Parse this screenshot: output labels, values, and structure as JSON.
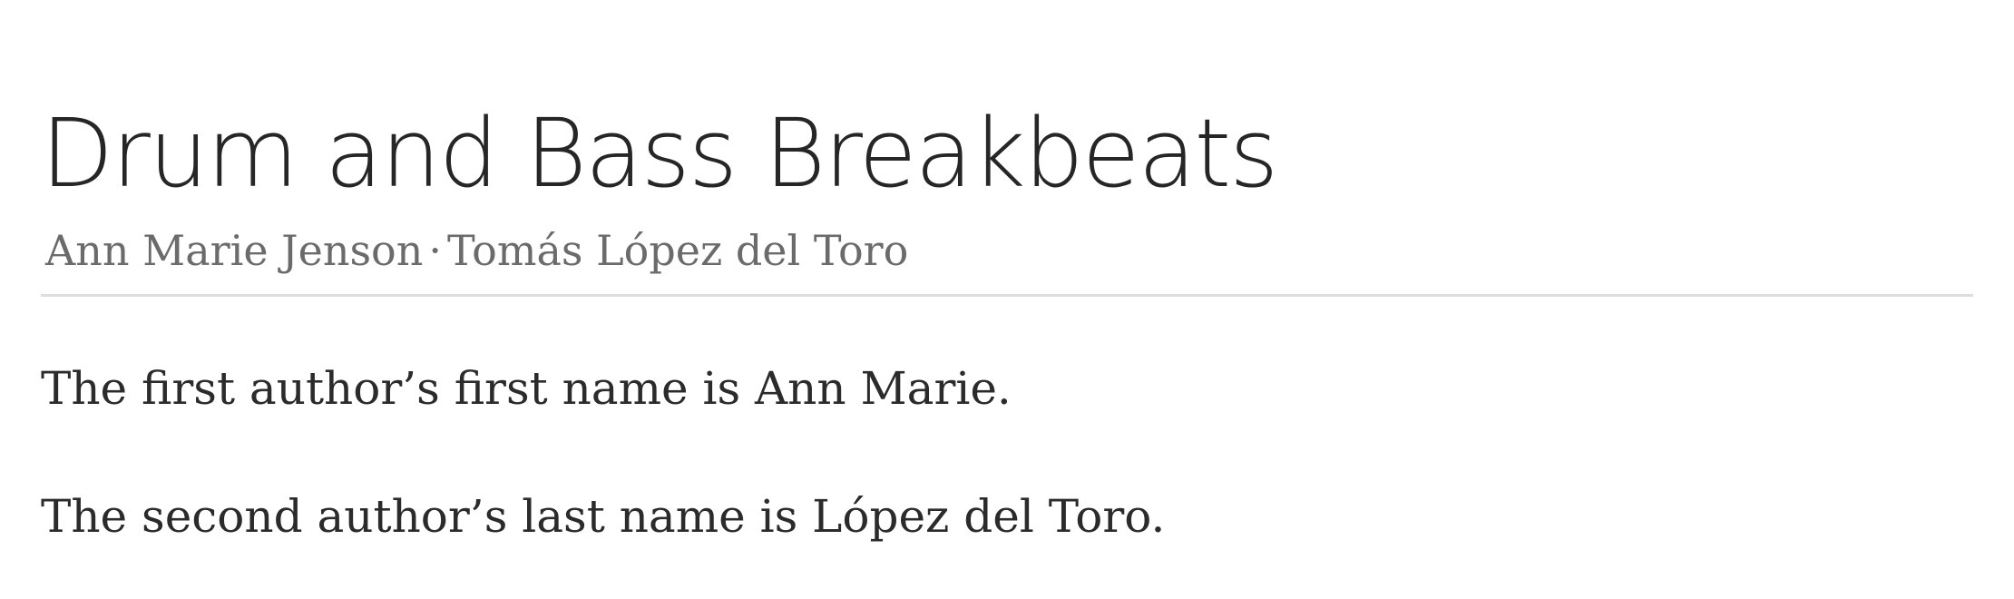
{
  "document": {
    "title": "Drum and Bass Breakbeats",
    "authors": [
      "Ann Marie Jenson",
      "Tomás López del Toro"
    ],
    "author_separator": "·",
    "paragraphs": [
      "The first author’s first name is Ann Marie.",
      "The second author’s last name is López del Toro."
    ]
  },
  "colors": {
    "title": "#262626",
    "authors": "#6b6b6b",
    "body_text": "#2b2b2b",
    "rule": "#dedede",
    "background": "#ffffff"
  }
}
